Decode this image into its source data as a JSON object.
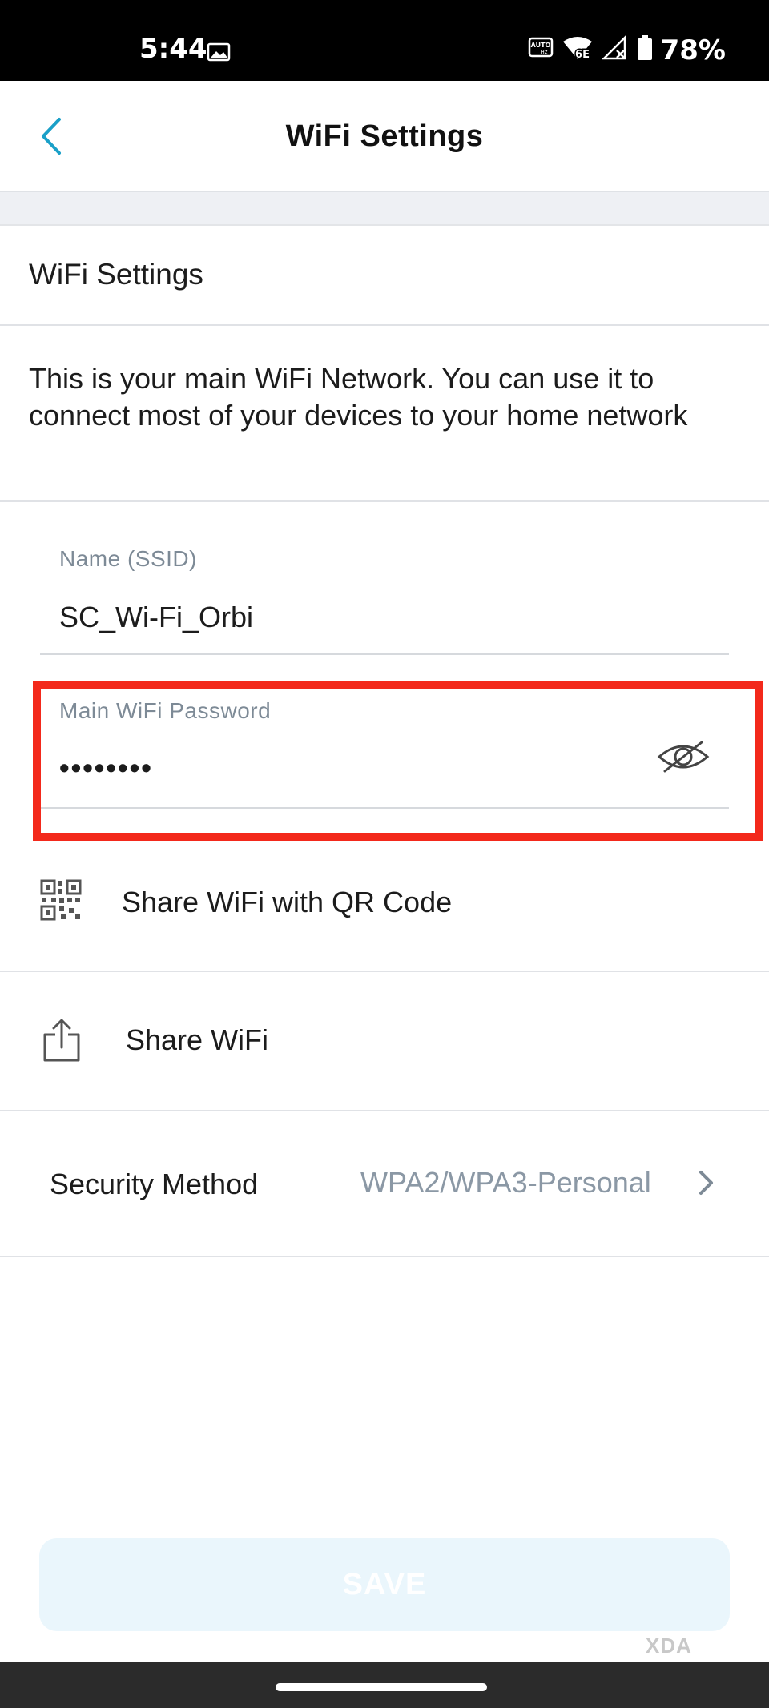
{
  "status_bar": {
    "time": "5:44",
    "battery": "78%",
    "network": "6E",
    "icons": [
      "image-icon",
      "auto-hz-icon",
      "wifi-6e-icon",
      "no-signal-icon",
      "battery-icon"
    ]
  },
  "header": {
    "title": "WiFi Settings",
    "back_icon": "chevron-left-icon"
  },
  "section": {
    "title": "WiFi Settings",
    "description": "This is your main WiFi Network. You can use it to connect most of your devices to your home network"
  },
  "fields": {
    "ssid": {
      "label": "Name (SSID)",
      "value": "SC_Wi-Fi_Orbi"
    },
    "password": {
      "label": "Main WiFi Password",
      "value": "••••••••",
      "toggle_icon": "eye-off-icon"
    }
  },
  "actions": {
    "share_qr": {
      "label": "Share WiFi with QR Code",
      "icon": "qr-code-icon"
    },
    "share_wifi": {
      "label": "Share WiFi",
      "icon": "share-icon"
    }
  },
  "security": {
    "label": "Security Method",
    "value": "WPA2/WPA3-Personal"
  },
  "save": {
    "label": "SAVE",
    "enabled": false
  },
  "watermark": "XDA",
  "colors": {
    "accent": "#1aa0c8",
    "highlight": "#f3291b",
    "muted_text": "#8b98a5",
    "save_bg": "#eaf6fc"
  }
}
